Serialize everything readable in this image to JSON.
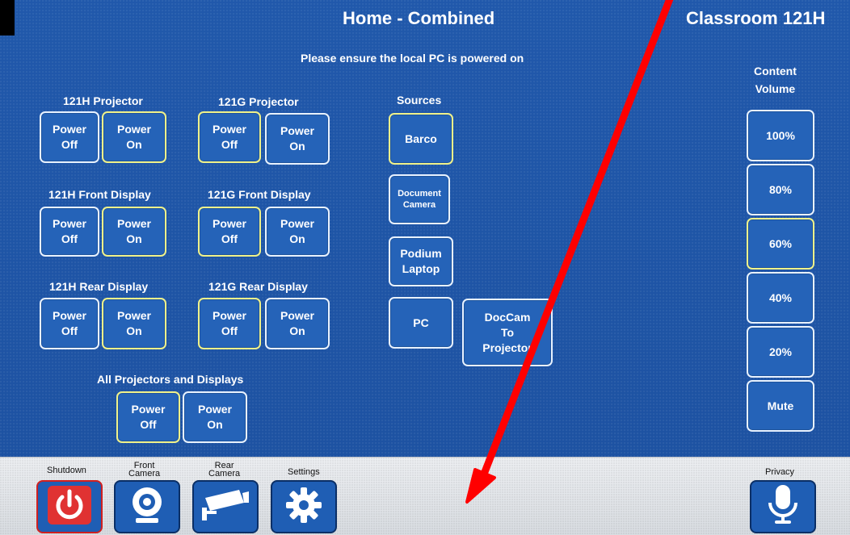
{
  "header": {
    "title": "Home - Combined",
    "room": "Classroom 121H",
    "notice": "Please ensure the local PC is powered on"
  },
  "groups": {
    "h_projector": {
      "label": "121H Projector",
      "off": "Power\nOff",
      "on": "Power\nOn"
    },
    "g_projector": {
      "label": "121G Projector",
      "off": "Power\nOff",
      "on": "Power\nOn"
    },
    "h_front": {
      "label": "121H Front Display",
      "off": "Power\nOff",
      "on": "Power\nOn"
    },
    "g_front": {
      "label": "121G Front Display",
      "off": "Power\nOff",
      "on": "Power\nOn"
    },
    "h_rear": {
      "label": "121H Rear Display",
      "off": "Power\nOff",
      "on": "Power\nOn"
    },
    "g_rear": {
      "label": "121G Rear Display",
      "off": "Power\nOff",
      "on": "Power\nOn"
    },
    "all": {
      "label": "All Projectors and Displays",
      "off": "Power\nOff",
      "on": "Power\nOn"
    }
  },
  "sources": {
    "label": "Sources",
    "barco": "Barco",
    "doc_camera": "Document\nCamera",
    "podium_laptop": "Podium\nLaptop",
    "pc": "PC",
    "doccam_to_projector": "DocCam\nTo\nProjector"
  },
  "volume": {
    "label": "Content\nVolume",
    "levels": [
      "100%",
      "80%",
      "60%",
      "40%",
      "20%",
      "Mute"
    ],
    "selected": "60%"
  },
  "bottom_bar": {
    "shutdown": "Shutdown",
    "front_camera": "Front\nCamera",
    "rear_camera": "Rear\nCamera",
    "settings": "Settings",
    "privacy": "Privacy"
  },
  "colors": {
    "background": "#1f56a6",
    "button": "#2563b8",
    "selected_border": "#f0f28a",
    "annotation_arrow": "#ff0000"
  },
  "icons": {
    "shutdown": "power-icon",
    "front_camera": "webcam-icon",
    "rear_camera": "security-camera-icon",
    "settings": "gear-icon",
    "privacy": "microphone-icon"
  }
}
